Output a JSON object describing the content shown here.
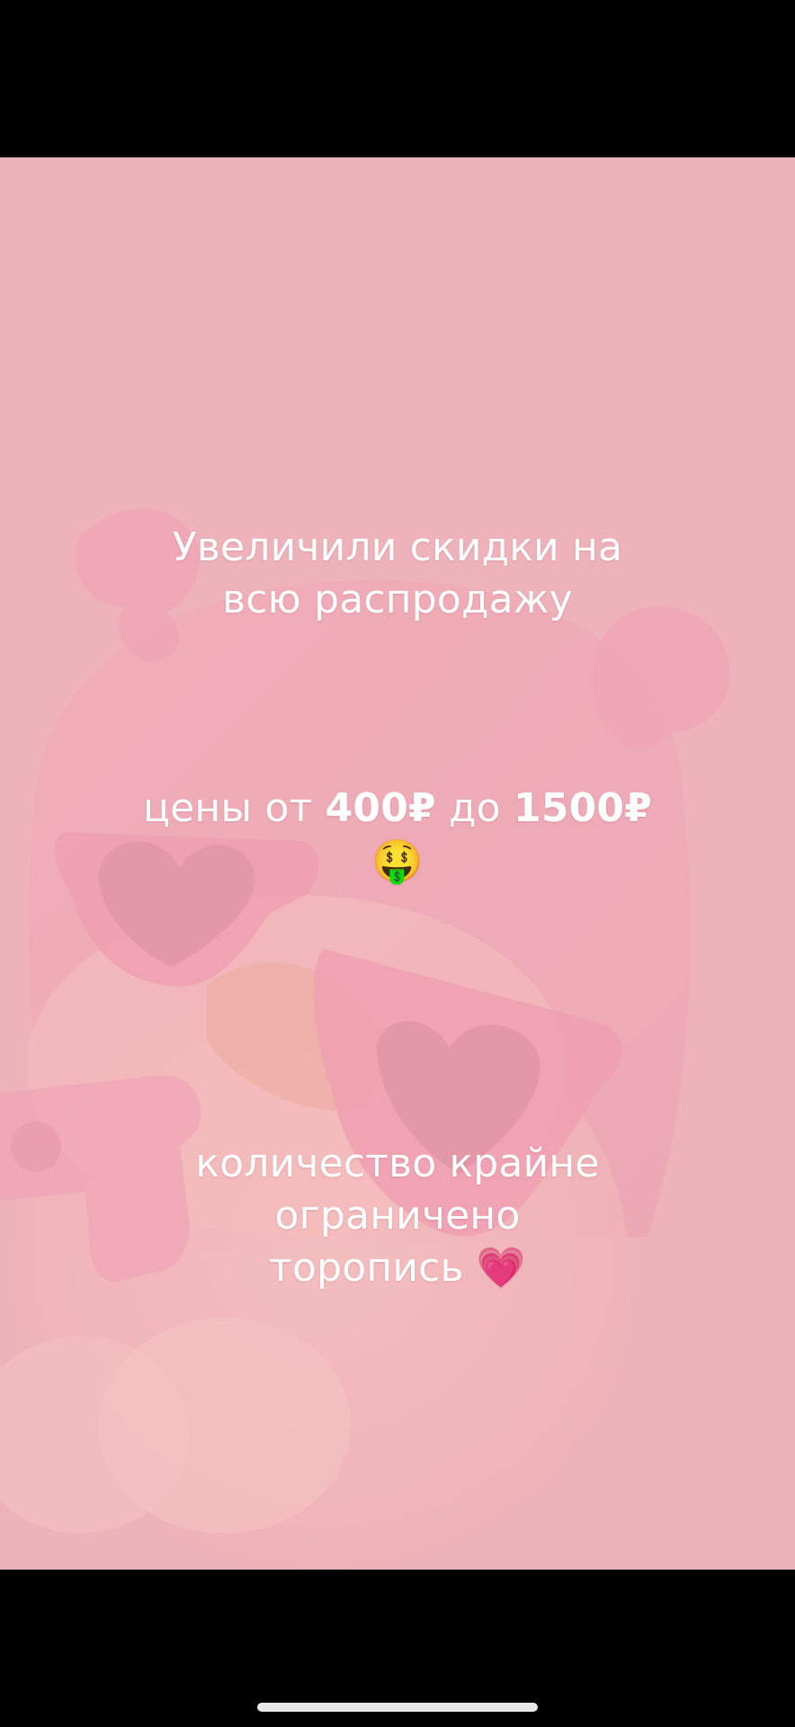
{
  "story": {
    "line1": "Увеличили скидки на",
    "line2": "всю распродажу",
    "price_prefix": "цены от ",
    "price_from": "400₽",
    "price_mid": " до ",
    "price_to": "1500₽",
    "price_emoji": "🤑",
    "line5": "количество крайне",
    "line6": "ограничено",
    "line7": "торопись",
    "line7_emoji": "💗"
  },
  "colors": {
    "background": "#efb3bb",
    "text": "#ffffff",
    "letterbox": "#000000",
    "home_indicator": "#e9e9e9"
  }
}
